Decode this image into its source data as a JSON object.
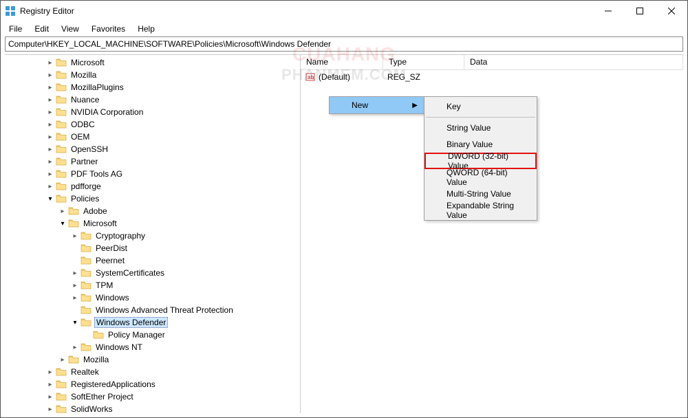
{
  "titlebar": {
    "title": "Registry Editor"
  },
  "menus": {
    "file": "File",
    "edit": "Edit",
    "view": "View",
    "favorites": "Favorites",
    "help": "Help"
  },
  "address": {
    "path": "Computer\\HKEY_LOCAL_MACHINE\\SOFTWARE\\Policies\\Microsoft\\Windows Defender"
  },
  "tree": [
    {
      "indent": 58,
      "chev": "closed",
      "label": "Microsoft"
    },
    {
      "indent": 58,
      "chev": "closed",
      "label": "Mozilla"
    },
    {
      "indent": 58,
      "chev": "closed",
      "label": "MozillaPlugins"
    },
    {
      "indent": 58,
      "chev": "closed",
      "label": "Nuance"
    },
    {
      "indent": 58,
      "chev": "closed",
      "label": "NVIDIA Corporation"
    },
    {
      "indent": 58,
      "chev": "closed",
      "label": "ODBC"
    },
    {
      "indent": 58,
      "chev": "closed",
      "label": "OEM"
    },
    {
      "indent": 58,
      "chev": "closed",
      "label": "OpenSSH"
    },
    {
      "indent": 58,
      "chev": "closed",
      "label": "Partner"
    },
    {
      "indent": 58,
      "chev": "closed",
      "label": "PDF Tools AG"
    },
    {
      "indent": 58,
      "chev": "closed",
      "label": "pdfforge"
    },
    {
      "indent": 58,
      "chev": "open",
      "label": "Policies"
    },
    {
      "indent": 76,
      "chev": "closed",
      "label": "Adobe"
    },
    {
      "indent": 76,
      "chev": "open",
      "label": "Microsoft"
    },
    {
      "indent": 94,
      "chev": "closed",
      "label": "Cryptography"
    },
    {
      "indent": 94,
      "chev": "none",
      "label": "PeerDist"
    },
    {
      "indent": 94,
      "chev": "none",
      "label": "Peernet"
    },
    {
      "indent": 94,
      "chev": "closed",
      "label": "SystemCertificates"
    },
    {
      "indent": 94,
      "chev": "closed",
      "label": "TPM"
    },
    {
      "indent": 94,
      "chev": "closed",
      "label": "Windows"
    },
    {
      "indent": 94,
      "chev": "none",
      "label": "Windows Advanced Threat Protection"
    },
    {
      "indent": 94,
      "chev": "open",
      "label": "Windows Defender",
      "selected": true
    },
    {
      "indent": 112,
      "chev": "none",
      "label": "Policy Manager"
    },
    {
      "indent": 94,
      "chev": "closed",
      "label": "Windows NT"
    },
    {
      "indent": 76,
      "chev": "closed",
      "label": "Mozilla"
    },
    {
      "indent": 58,
      "chev": "closed",
      "label": "Realtek"
    },
    {
      "indent": 58,
      "chev": "closed",
      "label": "RegisteredApplications"
    },
    {
      "indent": 58,
      "chev": "closed",
      "label": "SoftEther Project"
    },
    {
      "indent": 58,
      "chev": "closed",
      "label": "SolidWorks"
    }
  ],
  "list": {
    "headers": {
      "name": "Name",
      "type": "Type",
      "data": "Data"
    },
    "rows": [
      {
        "name": "(Default)",
        "type": "REG_SZ",
        "data": ""
      }
    ]
  },
  "context": {
    "main": {
      "new": "New"
    },
    "sub": {
      "key": "Key",
      "string": "String Value",
      "binary": "Binary Value",
      "dword": "DWORD (32-bit) Value",
      "qword": "QWORD (64-bit) Value",
      "multi": "Multi-String Value",
      "expand": "Expandable String Value"
    }
  },
  "watermark": {
    "line1": "CUAHANG",
    "line2": "PHANMEM.COM"
  }
}
